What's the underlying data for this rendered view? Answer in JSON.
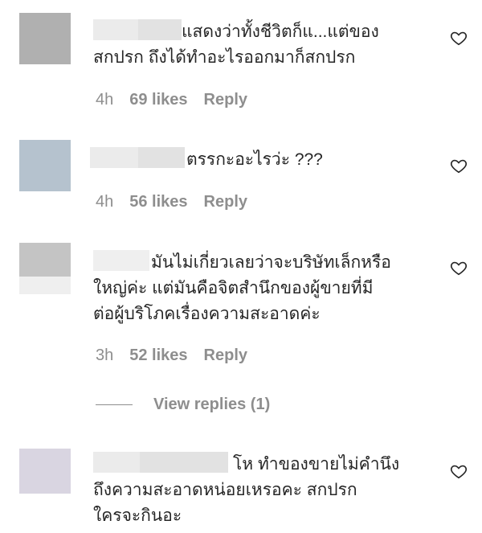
{
  "comments": [
    {
      "text": "แสดงว่าทั้งชีวิตก็แ...แต่ของ\nสกปรก ถึงได้ทำอะไรออกมาก็สกปรก",
      "time": "4h",
      "likes": "69 likes",
      "reply": "Reply",
      "avatar_color": "#b0b0b0"
    },
    {
      "text": "ตรรกะอะไรว่ะ ???",
      "time": "4h",
      "likes": "56 likes",
      "reply": "Reply",
      "avatar_color": "#b5c2ce"
    },
    {
      "text": "มันไม่เกี่ยวเลยว่าจะบริษัทเล็กหรือ\nใหญ่ค่ะ แต่มันคือจิตสำนึกของผู้ขายที่มี\nต่อผู้บริโภคเรื่องความสะอาดค่ะ",
      "time": "3h",
      "likes": "52 likes",
      "reply": "Reply",
      "avatar_color": "#c4c4c4"
    },
    {
      "text": "โห ทำของขายไม่คำนึง\nถึงความสะอาดหน่อยเหรอคะ สกปรก\nใครจะกินอะ",
      "avatar_color": "#d9d5e1"
    }
  ],
  "view_replies": "View replies (1)",
  "icons": {
    "heart": "heart-icon"
  }
}
